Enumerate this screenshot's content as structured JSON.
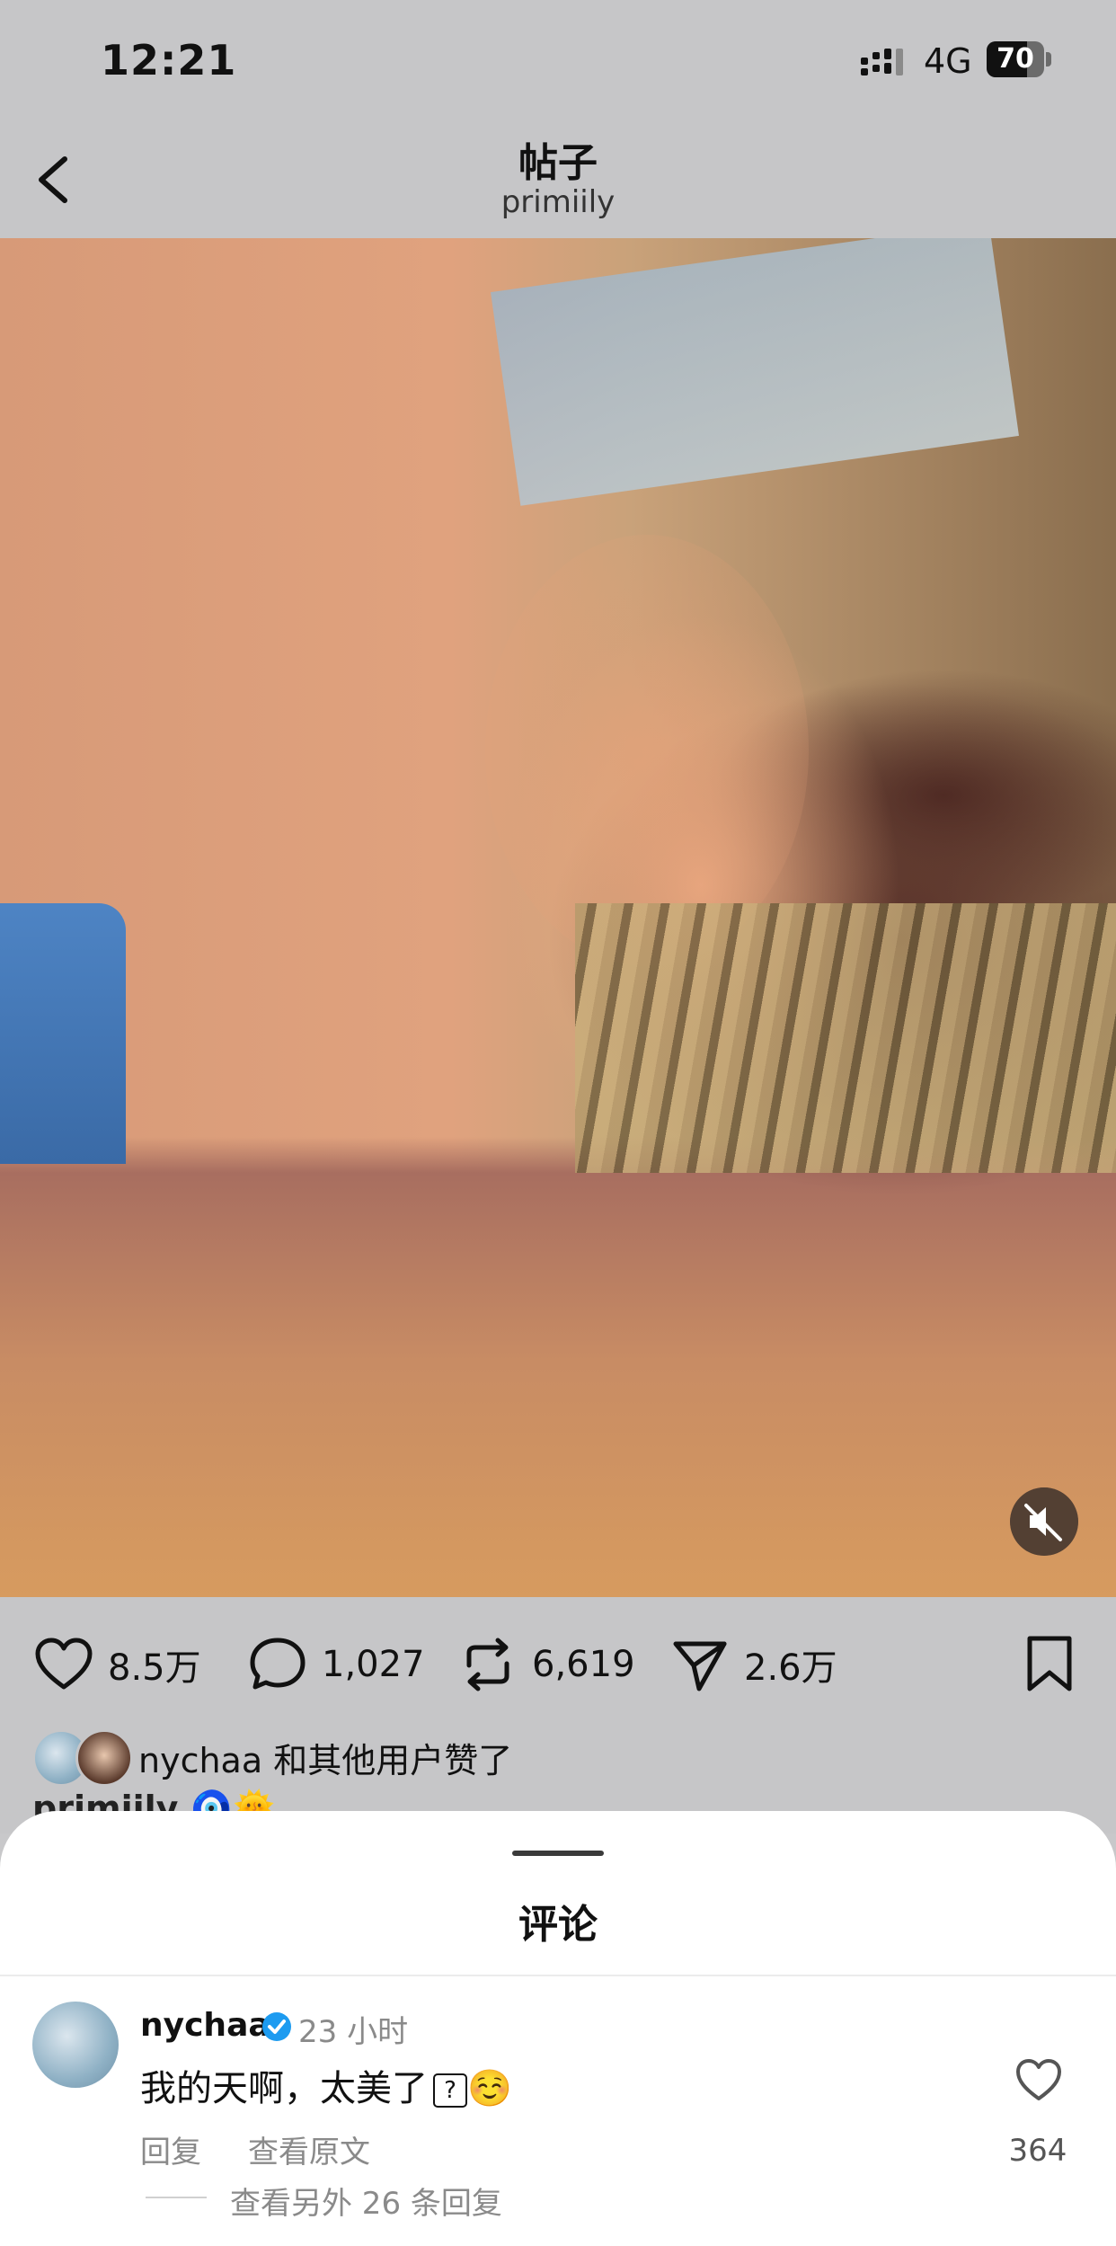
{
  "status_bar": {
    "time": "12:21",
    "network": "4G",
    "battery": "70",
    "battery_level": 0.7
  },
  "nav": {
    "title": "帖子",
    "subtitle": "primiily"
  },
  "actions": {
    "likes": "8.5万",
    "comments": "1,027",
    "reposts": "6,619",
    "shares": "2.6万"
  },
  "liked_by": {
    "text": "nychaa 和其他用户赞了"
  },
  "caption": {
    "user": "primiily",
    "emoji": "🧿🌞"
  },
  "comments_sheet": {
    "title": "评论",
    "comment": {
      "user": "nychaa",
      "time": "23 小时",
      "text": "我的天啊，太美了",
      "unknown_glyph": "?",
      "emoji": "☺️",
      "reply_label": "回复",
      "original_label": "查看原文",
      "like_count": "364"
    },
    "more_replies": "查看另外 26 条回复"
  },
  "icons": {
    "back": "chevron-left-icon",
    "mute": "speaker-muted-icon",
    "like": "heart-icon",
    "comment": "speech-bubble-icon",
    "repost": "repost-icon",
    "share": "send-icon",
    "bookmark": "bookmark-icon",
    "verified": "verified-badge-icon"
  },
  "colors": {
    "verified": "#1d9bf0",
    "muted_text": "#8a8a8a",
    "overlay": "#c6c6c8"
  }
}
